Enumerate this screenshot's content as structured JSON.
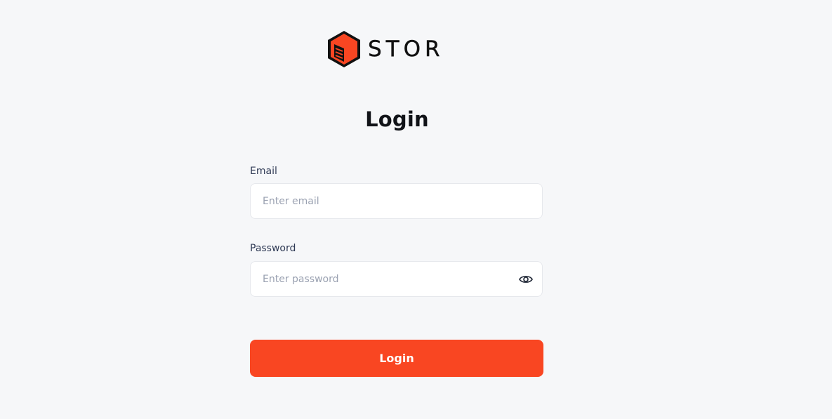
{
  "brand": {
    "name": "STOR",
    "logo_icon": "box-logo-icon",
    "accent_color": "#f94622"
  },
  "page": {
    "title": "Login"
  },
  "form": {
    "email": {
      "label": "Email",
      "placeholder": "Enter email",
      "value": ""
    },
    "password": {
      "label": "Password",
      "placeholder": "Enter password",
      "value": "",
      "toggle_icon": "eye-icon"
    },
    "submit_label": "Login"
  }
}
